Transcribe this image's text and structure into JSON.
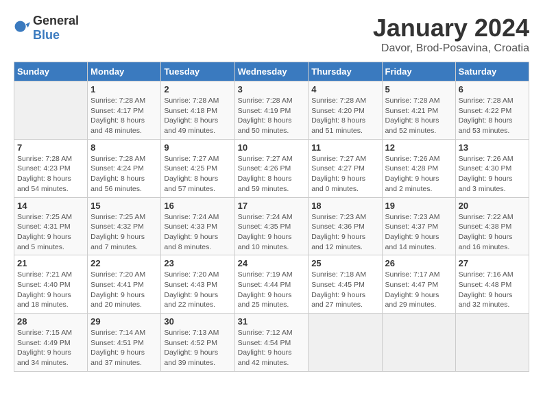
{
  "header": {
    "logo_general": "General",
    "logo_blue": "Blue",
    "title": "January 2024",
    "subtitle": "Davor, Brod-Posavina, Croatia"
  },
  "days_of_week": [
    "Sunday",
    "Monday",
    "Tuesday",
    "Wednesday",
    "Thursday",
    "Friday",
    "Saturday"
  ],
  "weeks": [
    [
      {
        "day": "",
        "info": ""
      },
      {
        "day": "1",
        "info": "Sunrise: 7:28 AM\nSunset: 4:17 PM\nDaylight: 8 hours\nand 48 minutes."
      },
      {
        "day": "2",
        "info": "Sunrise: 7:28 AM\nSunset: 4:18 PM\nDaylight: 8 hours\nand 49 minutes."
      },
      {
        "day": "3",
        "info": "Sunrise: 7:28 AM\nSunset: 4:19 PM\nDaylight: 8 hours\nand 50 minutes."
      },
      {
        "day": "4",
        "info": "Sunrise: 7:28 AM\nSunset: 4:20 PM\nDaylight: 8 hours\nand 51 minutes."
      },
      {
        "day": "5",
        "info": "Sunrise: 7:28 AM\nSunset: 4:21 PM\nDaylight: 8 hours\nand 52 minutes."
      },
      {
        "day": "6",
        "info": "Sunrise: 7:28 AM\nSunset: 4:22 PM\nDaylight: 8 hours\nand 53 minutes."
      }
    ],
    [
      {
        "day": "7",
        "info": "Sunrise: 7:28 AM\nSunset: 4:23 PM\nDaylight: 8 hours\nand 54 minutes."
      },
      {
        "day": "8",
        "info": "Sunrise: 7:28 AM\nSunset: 4:24 PM\nDaylight: 8 hours\nand 56 minutes."
      },
      {
        "day": "9",
        "info": "Sunrise: 7:27 AM\nSunset: 4:25 PM\nDaylight: 8 hours\nand 57 minutes."
      },
      {
        "day": "10",
        "info": "Sunrise: 7:27 AM\nSunset: 4:26 PM\nDaylight: 8 hours\nand 59 minutes."
      },
      {
        "day": "11",
        "info": "Sunrise: 7:27 AM\nSunset: 4:27 PM\nDaylight: 9 hours\nand 0 minutes."
      },
      {
        "day": "12",
        "info": "Sunrise: 7:26 AM\nSunset: 4:28 PM\nDaylight: 9 hours\nand 2 minutes."
      },
      {
        "day": "13",
        "info": "Sunrise: 7:26 AM\nSunset: 4:30 PM\nDaylight: 9 hours\nand 3 minutes."
      }
    ],
    [
      {
        "day": "14",
        "info": "Sunrise: 7:25 AM\nSunset: 4:31 PM\nDaylight: 9 hours\nand 5 minutes."
      },
      {
        "day": "15",
        "info": "Sunrise: 7:25 AM\nSunset: 4:32 PM\nDaylight: 9 hours\nand 7 minutes."
      },
      {
        "day": "16",
        "info": "Sunrise: 7:24 AM\nSunset: 4:33 PM\nDaylight: 9 hours\nand 8 minutes."
      },
      {
        "day": "17",
        "info": "Sunrise: 7:24 AM\nSunset: 4:35 PM\nDaylight: 9 hours\nand 10 minutes."
      },
      {
        "day": "18",
        "info": "Sunrise: 7:23 AM\nSunset: 4:36 PM\nDaylight: 9 hours\nand 12 minutes."
      },
      {
        "day": "19",
        "info": "Sunrise: 7:23 AM\nSunset: 4:37 PM\nDaylight: 9 hours\nand 14 minutes."
      },
      {
        "day": "20",
        "info": "Sunrise: 7:22 AM\nSunset: 4:38 PM\nDaylight: 9 hours\nand 16 minutes."
      }
    ],
    [
      {
        "day": "21",
        "info": "Sunrise: 7:21 AM\nSunset: 4:40 PM\nDaylight: 9 hours\nand 18 minutes."
      },
      {
        "day": "22",
        "info": "Sunrise: 7:20 AM\nSunset: 4:41 PM\nDaylight: 9 hours\nand 20 minutes."
      },
      {
        "day": "23",
        "info": "Sunrise: 7:20 AM\nSunset: 4:43 PM\nDaylight: 9 hours\nand 22 minutes."
      },
      {
        "day": "24",
        "info": "Sunrise: 7:19 AM\nSunset: 4:44 PM\nDaylight: 9 hours\nand 25 minutes."
      },
      {
        "day": "25",
        "info": "Sunrise: 7:18 AM\nSunset: 4:45 PM\nDaylight: 9 hours\nand 27 minutes."
      },
      {
        "day": "26",
        "info": "Sunrise: 7:17 AM\nSunset: 4:47 PM\nDaylight: 9 hours\nand 29 minutes."
      },
      {
        "day": "27",
        "info": "Sunrise: 7:16 AM\nSunset: 4:48 PM\nDaylight: 9 hours\nand 32 minutes."
      }
    ],
    [
      {
        "day": "28",
        "info": "Sunrise: 7:15 AM\nSunset: 4:49 PM\nDaylight: 9 hours\nand 34 minutes."
      },
      {
        "day": "29",
        "info": "Sunrise: 7:14 AM\nSunset: 4:51 PM\nDaylight: 9 hours\nand 37 minutes."
      },
      {
        "day": "30",
        "info": "Sunrise: 7:13 AM\nSunset: 4:52 PM\nDaylight: 9 hours\nand 39 minutes."
      },
      {
        "day": "31",
        "info": "Sunrise: 7:12 AM\nSunset: 4:54 PM\nDaylight: 9 hours\nand 42 minutes."
      },
      {
        "day": "",
        "info": ""
      },
      {
        "day": "",
        "info": ""
      },
      {
        "day": "",
        "info": ""
      }
    ]
  ]
}
